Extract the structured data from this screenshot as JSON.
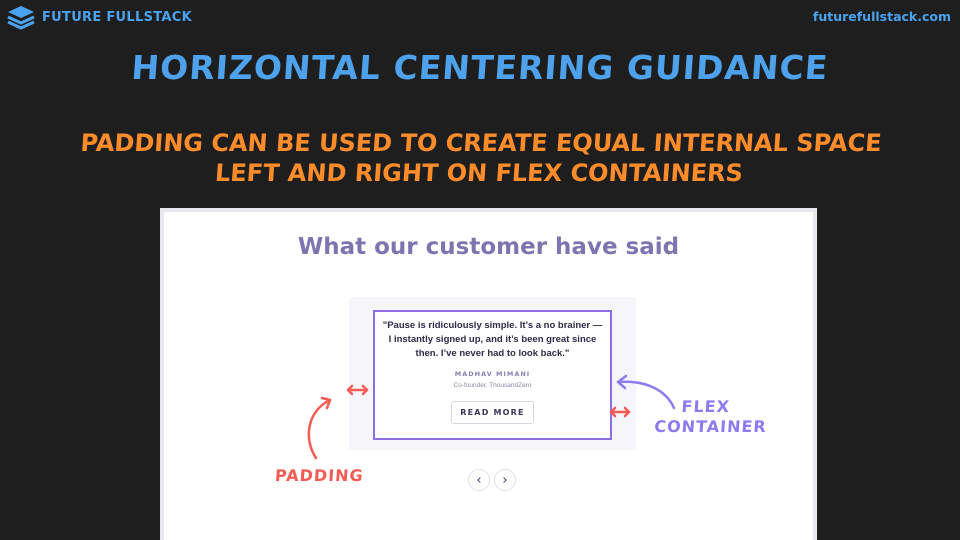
{
  "brand": {
    "name": "FUTURE FULLSTACK",
    "icon": "stacked-layers-icon",
    "color": "#4aa3f0"
  },
  "site_url": "futurefullstack.com",
  "slide": {
    "title": "Horizontal Centering Guidance",
    "subtitle_line1": "Padding can be used to create equal internal space",
    "subtitle_line2": "left and right on flex containers"
  },
  "demo": {
    "heading": "What our customer have said",
    "testimonial": {
      "quote": "\"Pause is ridiculously simple. It’s a no brainer — I instantly signed up, and it’s been great since then. I’ve never had to look back.\"",
      "name": "MADHAV MIMANI",
      "role": "Co-founder, ThousandZero",
      "button_label": "READ MORE"
    },
    "carousel": {
      "prev_icon": "chevron-left-icon",
      "next_icon": "chevron-right-icon",
      "prev_glyph": "‹",
      "next_glyph": "›"
    }
  },
  "annotations": {
    "padding_label": "PADDING",
    "flex_label_line1": "FLEX",
    "flex_label_line2": "CONTAINER",
    "padding_color": "#f25c54",
    "flex_color": "#8f7af0"
  }
}
